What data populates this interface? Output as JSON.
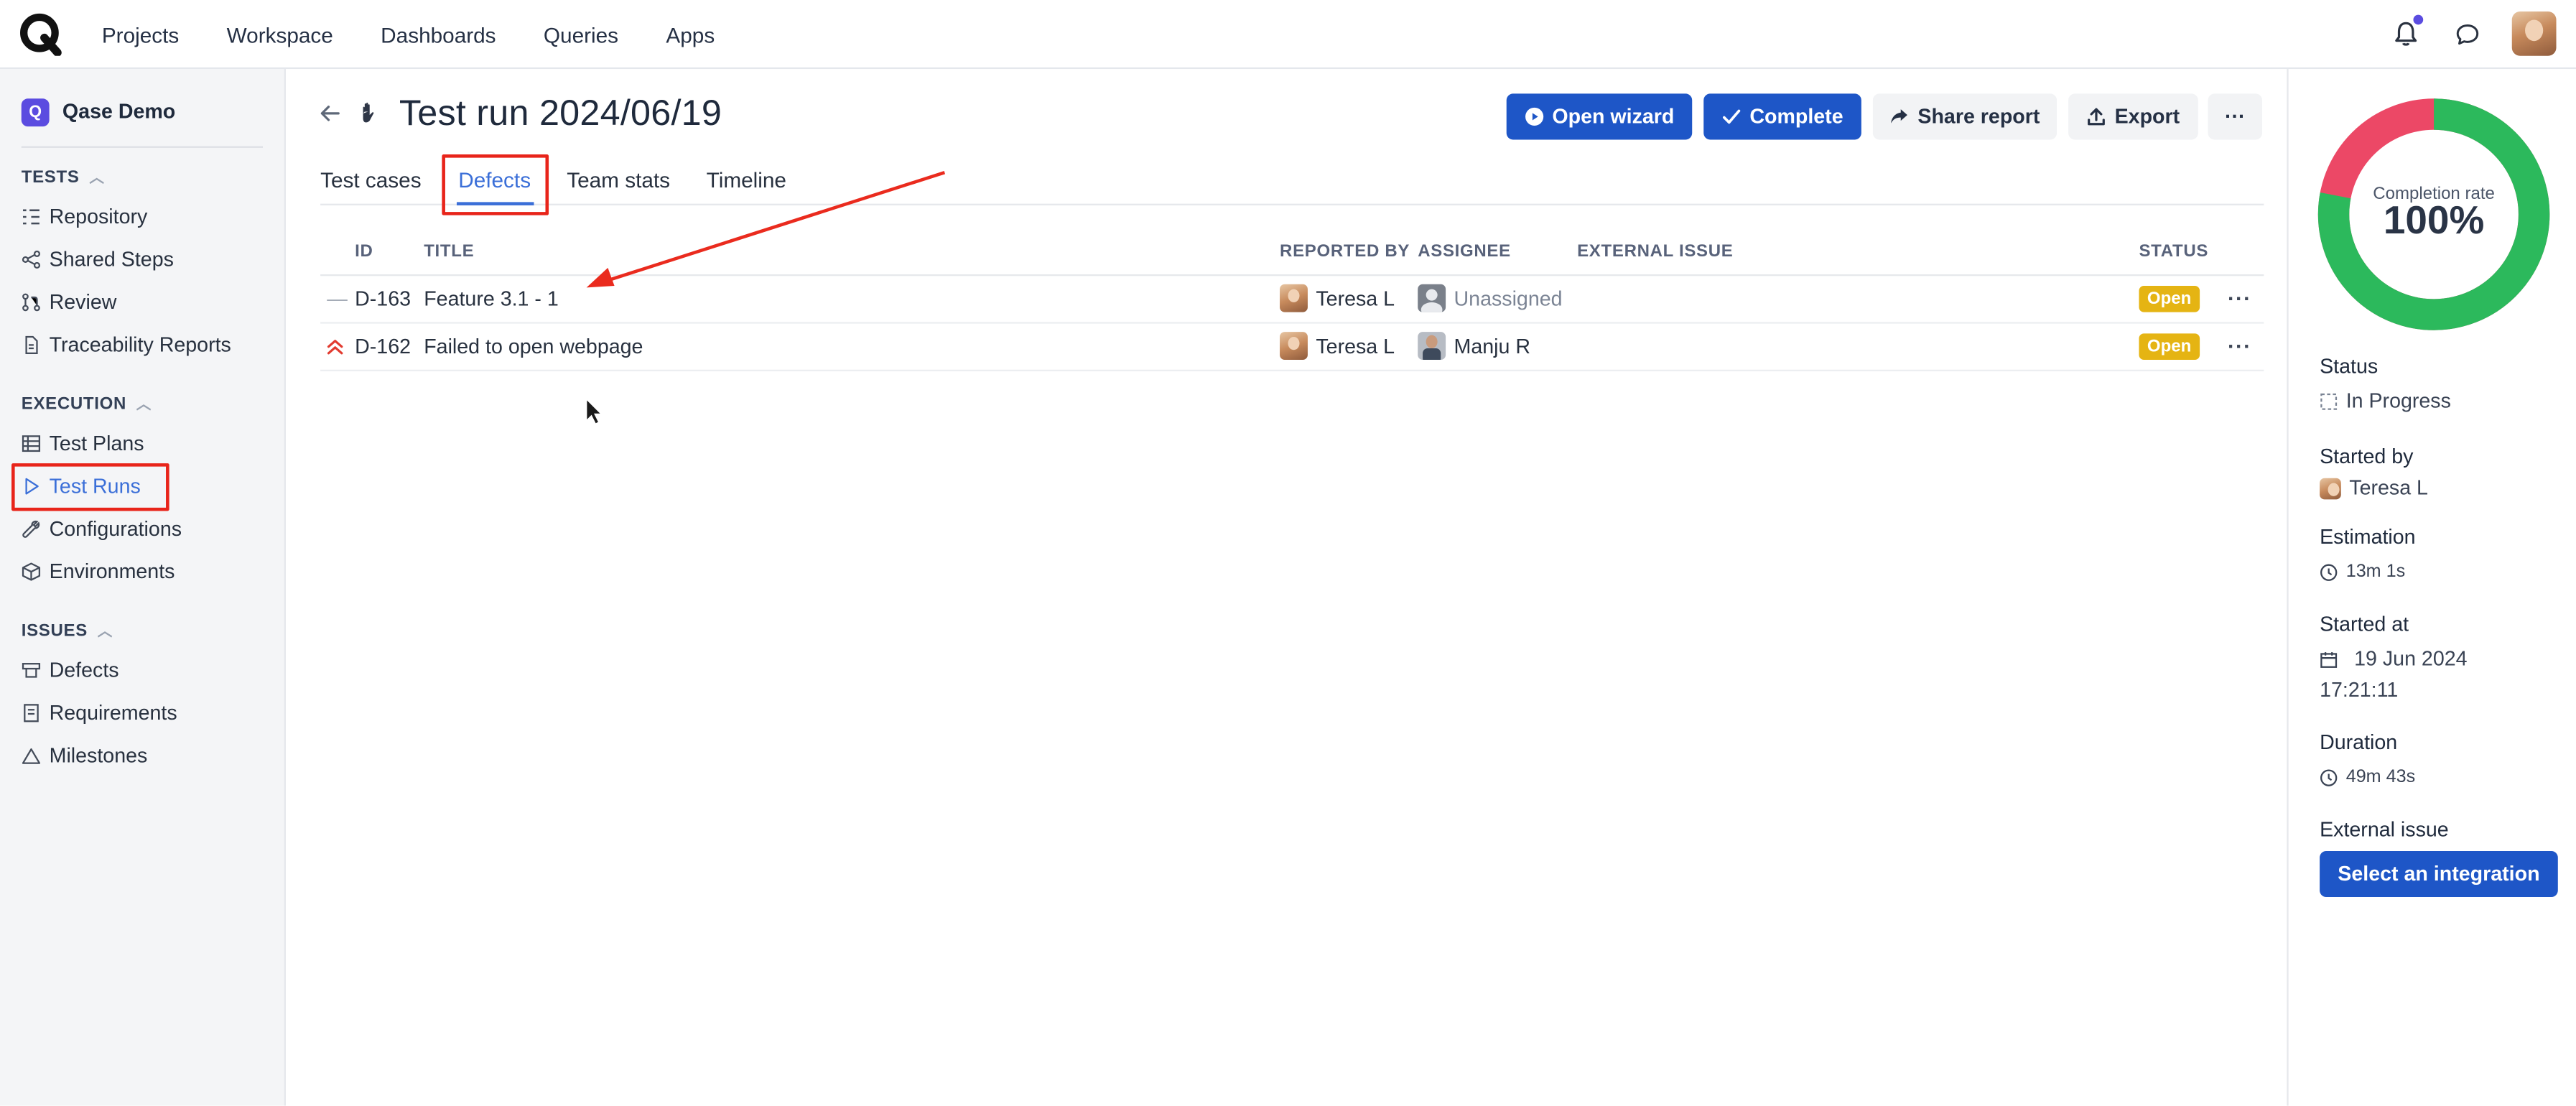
{
  "topnav": {
    "items": [
      "Projects",
      "Workspace",
      "Dashboards",
      "Queries",
      "Apps"
    ]
  },
  "sidebar": {
    "project_name": "Qase Demo",
    "project_icon_letter": "Q",
    "sections": {
      "tests": "TESTS",
      "execution": "EXECUTION",
      "issues": "ISSUES"
    },
    "items": {
      "repository": "Repository",
      "shared_steps": "Shared Steps",
      "review": "Review",
      "traceability": "Traceability Reports",
      "test_plans": "Test Plans",
      "test_runs": "Test Runs",
      "configurations": "Configurations",
      "environments": "Environments",
      "defects": "Defects",
      "requirements": "Requirements",
      "milestones": "Milestones"
    }
  },
  "header": {
    "title": "Test run 2024/06/19",
    "buttons": {
      "open_wizard": "Open wizard",
      "complete": "Complete",
      "share_report": "Share report",
      "export": "Export",
      "more": "···"
    }
  },
  "tabs": [
    "Test cases",
    "Defects",
    "Team stats",
    "Timeline"
  ],
  "table": {
    "columns": {
      "id": "ID",
      "title": "TITLE",
      "reported_by": "REPORTED BY",
      "assignee": "ASSIGNEE",
      "external_issue": "EXTERNAL ISSUE",
      "status": "STATUS"
    },
    "rows": [
      {
        "id": "D-163",
        "title": "Feature 3.1 - 1",
        "reported_by": "Teresa L",
        "assignee": "Unassigned",
        "status": "Open",
        "more": "···"
      },
      {
        "id": "D-162",
        "title": "Failed to open webpage",
        "reported_by": "Teresa L",
        "assignee": "Manju R",
        "status": "Open",
        "more": "···"
      }
    ]
  },
  "right_panel": {
    "completion_label": "Completion rate",
    "completion_value": "100%",
    "completion_fraction": 1.0,
    "passed_fraction": 0.78,
    "colors": {
      "passed": "#2cb95c",
      "failed": "#ec4866",
      "primary": "#1e56c7",
      "status_open": "#e5b413"
    },
    "status_label": "Status",
    "status_value": "In Progress",
    "started_by_label": "Started by",
    "started_by_value": "Teresa L",
    "estimation_label": "Estimation",
    "estimation_value": "13m 1s",
    "started_at_label": "Started at",
    "started_at_date": "19 Jun 2024",
    "started_at_time": "17:21:11",
    "duration_label": "Duration",
    "duration_value": "49m 43s",
    "external_issue_label": "External issue",
    "integration_button": "Select an integration"
  }
}
